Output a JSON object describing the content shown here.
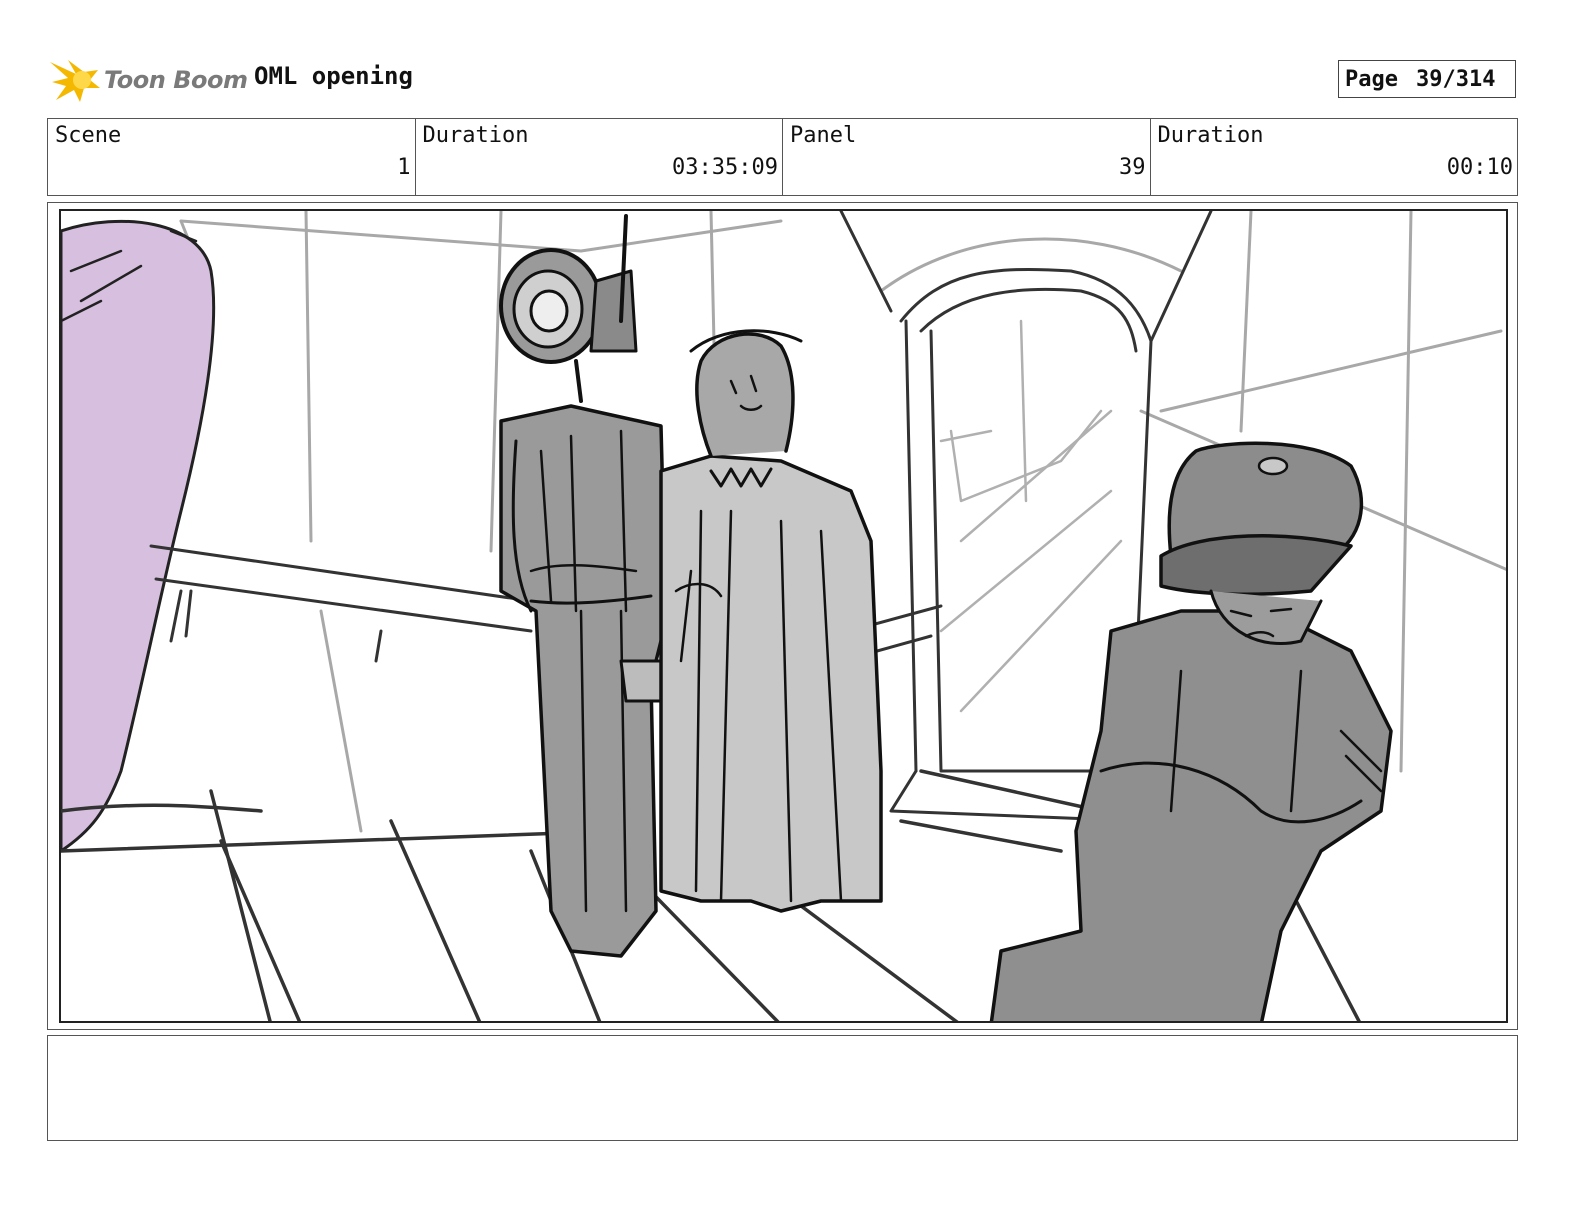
{
  "header": {
    "logo_text": "Toon Boom",
    "title": "OML opening",
    "page_label": "Page",
    "page_value": "39/314"
  },
  "info": [
    {
      "label": "Scene",
      "value": "1"
    },
    {
      "label": "Duration",
      "value": "03:35:09"
    },
    {
      "label": "Panel",
      "value": "39"
    },
    {
      "label": "Duration",
      "value": "00:10"
    }
  ],
  "notes": {
    "text": ""
  },
  "colors": {
    "logo_yellow": "#f5b800",
    "sketch_line": "#222222",
    "shade_dark": "#8f8f8f",
    "shade_light": "#c4c4c4",
    "purple_fill": "#d7c0df"
  }
}
